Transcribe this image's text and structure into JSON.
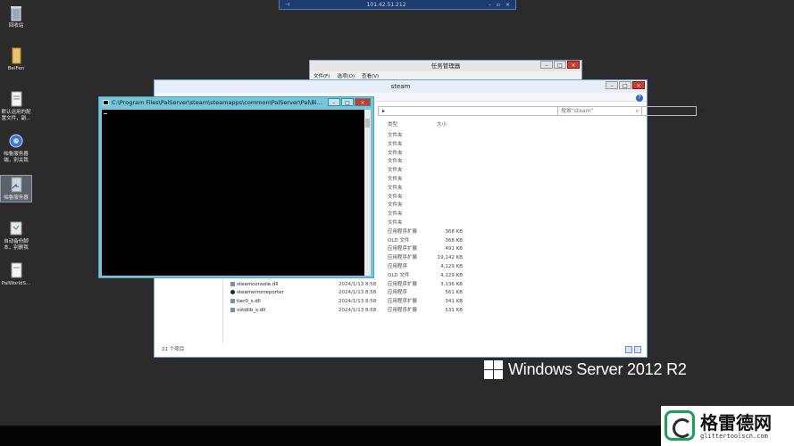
{
  "remote_bar": {
    "ip": "101.42.51.212"
  },
  "desktop_icons": [
    {
      "label": "回收站"
    },
    {
      "label": "BeiFen"
    },
    {
      "label": "默认运用的配置文件，副..."
    },
    {
      "label": "帕鲁服务器端，别关我"
    },
    {
      "label": "帕鲁服务器"
    },
    {
      "label": "自动备份脚本，别删我"
    },
    {
      "label": "PalWorldS..."
    }
  ],
  "task_manager": {
    "title": "任务管理器",
    "menu": [
      "文件(F)",
      "选项(O)",
      "查看(V)"
    ]
  },
  "explorer": {
    "title": "steam",
    "search_placeholder": "搜索\"steam\"",
    "col_type": "类型",
    "col_size": "大小",
    "status": "21 个项目",
    "rows": [
      {
        "name": "",
        "date": "",
        "type": "文件夹",
        "size": ""
      },
      {
        "name": "",
        "date": "",
        "type": "文件夹",
        "size": ""
      },
      {
        "name": "",
        "date": "",
        "type": "文件夹",
        "size": ""
      },
      {
        "name": "",
        "date": "",
        "type": "文件夹",
        "size": ""
      },
      {
        "name": "",
        "date": "",
        "type": "文件夹",
        "size": ""
      },
      {
        "name": "",
        "date": "",
        "type": "文件夹",
        "size": ""
      },
      {
        "name": "",
        "date": "",
        "type": "文件夹",
        "size": ""
      },
      {
        "name": "",
        "date": "",
        "type": "文件夹",
        "size": ""
      },
      {
        "name": "",
        "date": "",
        "type": "文件夹",
        "size": ""
      },
      {
        "name": "",
        "date": "",
        "type": "文件夹",
        "size": ""
      },
      {
        "name": "",
        "date": "",
        "type": "文件夹",
        "size": ""
      },
      {
        "name": "",
        "date": "",
        "type": "应用程序扩展",
        "size": "368 KB"
      },
      {
        "name": "",
        "date": "",
        "type": "OLD 文件",
        "size": "368 KB"
      },
      {
        "name": "",
        "date": "",
        "type": "应用程序扩展",
        "size": "491 KB"
      },
      {
        "name": "",
        "date": "",
        "type": "应用程序扩展",
        "size": "19,142 KB"
      },
      {
        "name": "",
        "date": "",
        "type": "应用程序",
        "size": "4,129 KB"
      },
      {
        "name": "",
        "date": "",
        "type": "OLD 文件",
        "size": "4,129 KB"
      },
      {
        "name": "steamconsole.dll",
        "date": "2024/1/13 8:58",
        "type": "应用程序扩展",
        "size": "3,136 KB"
      },
      {
        "name": "steamerrorreporter",
        "date": "2024/1/13 8:58",
        "type": "应用程序",
        "size": "561 KB"
      },
      {
        "name": "tier0_s.dll",
        "date": "2024/1/13 8:58",
        "type": "应用程序扩展",
        "size": "341 KB"
      },
      {
        "name": "vstdlib_s.dll",
        "date": "2024/1/13 8:58",
        "type": "应用程序扩展",
        "size": "531 KB"
      }
    ]
  },
  "console": {
    "title": "C:\\Program Files\\PalServer\\steam\\steamapps\\common\\PalServer\\Pal\\Bi..."
  },
  "branding": {
    "text": "Windows Server 2012 R2"
  },
  "watermark": {
    "name": "格雷德网",
    "url": "glittertoolscn.com"
  }
}
